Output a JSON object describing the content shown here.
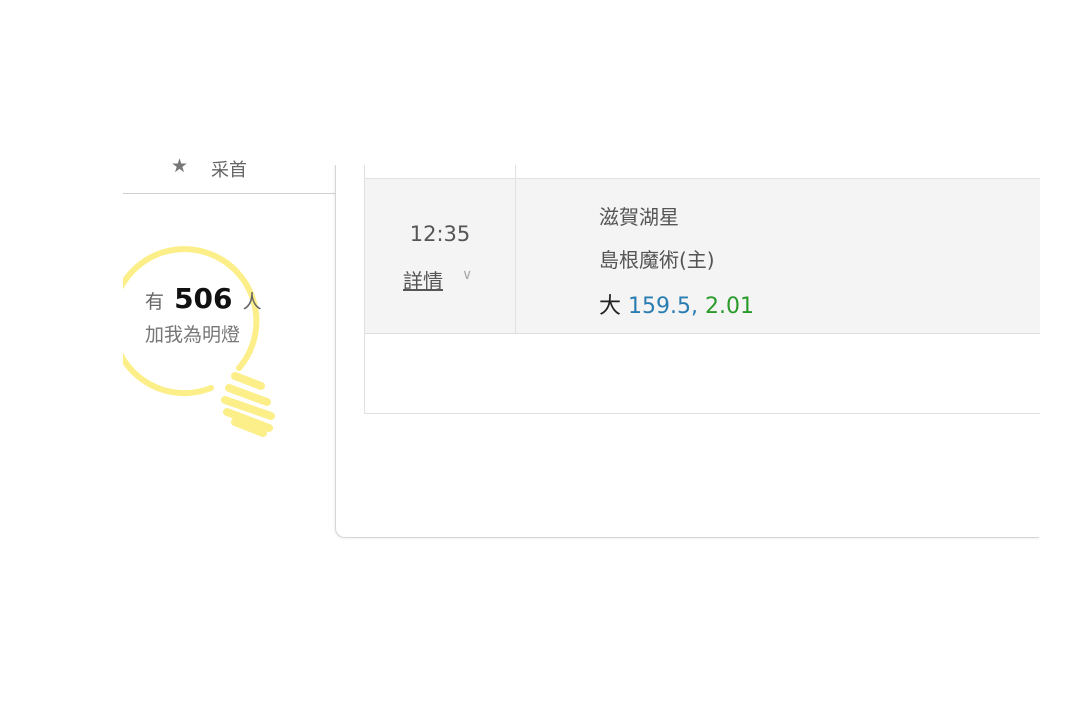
{
  "sidebar": {
    "menu_item_label": "采首",
    "bulb": {
      "prefix": "有",
      "count": "506",
      "suffix": "人",
      "line2": "加我為明燈"
    }
  },
  "match": {
    "time": "12:35",
    "details_label": "詳情",
    "away_team": "滋賀湖星",
    "home_team": "島根魔術(主)",
    "odds_type": "大",
    "odds_line": "159.5",
    "odds_separator": ",",
    "odds_price": "2.01"
  },
  "colors": {
    "bulb": "#fcef8a",
    "line_value": "#2a7db3",
    "price": "#2a9a2a",
    "row_background": "#f4f4f4"
  }
}
